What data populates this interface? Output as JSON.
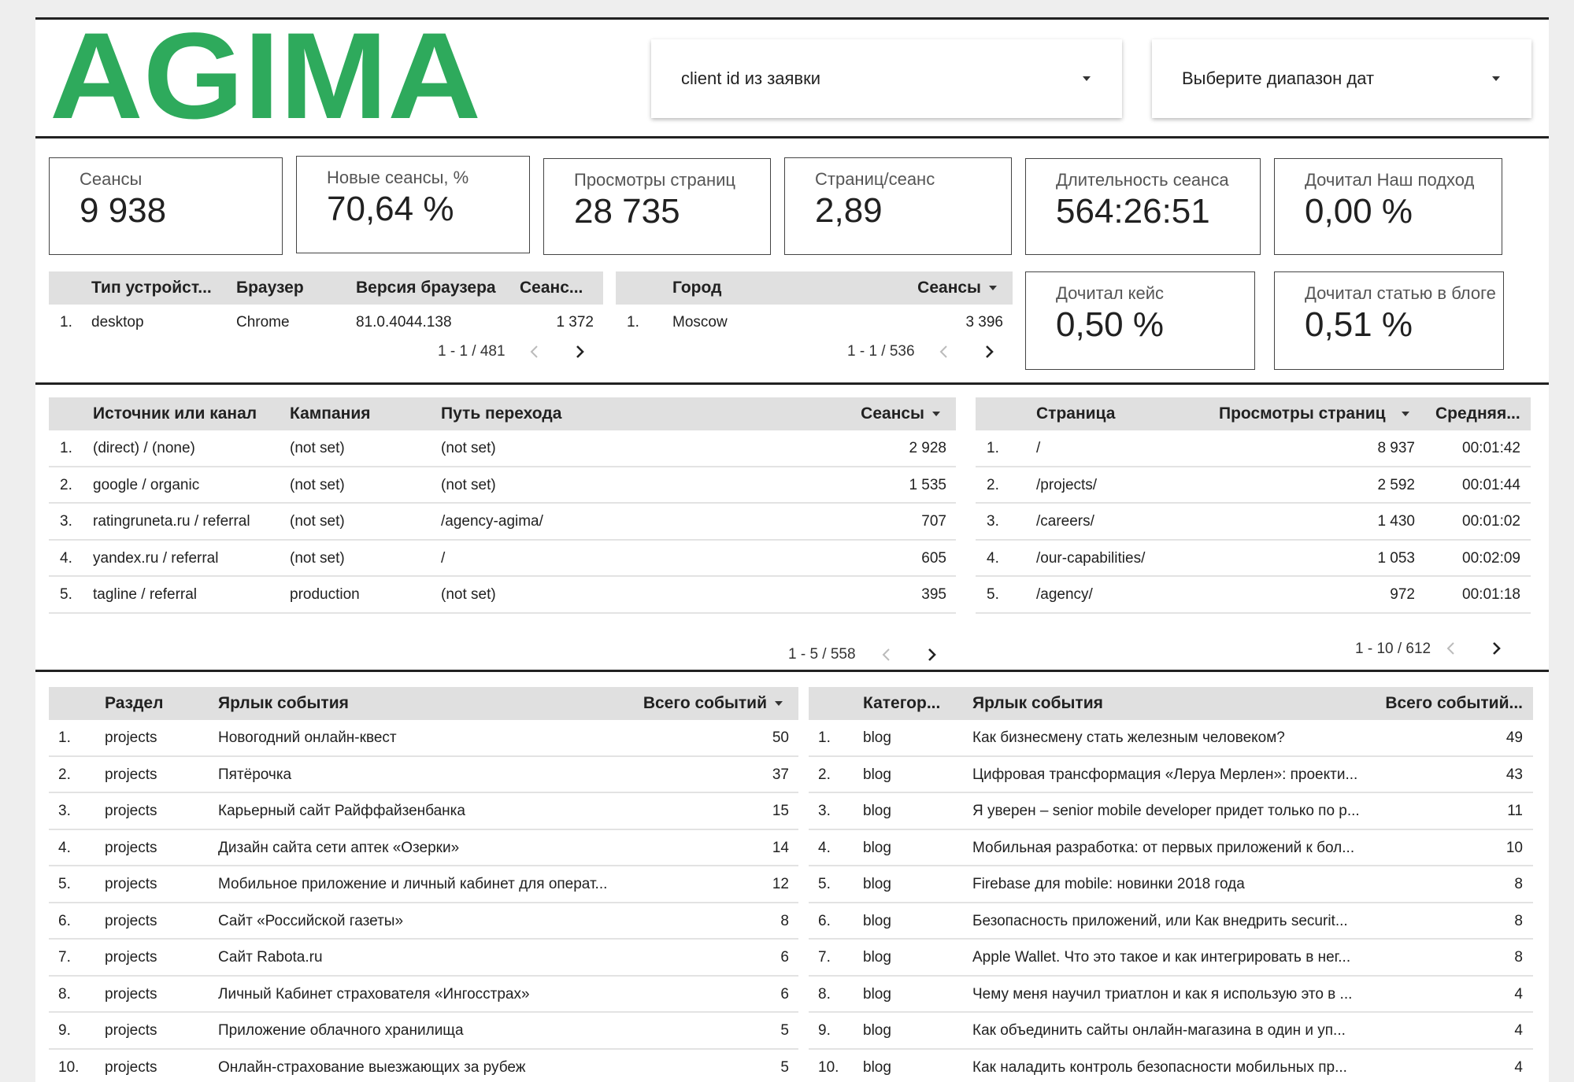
{
  "brand": {
    "logo_text": "AGIMA",
    "color": "#2eaa5c"
  },
  "filters": {
    "client_id": "client id из заявки",
    "date_range": "Выберите диапазон дат"
  },
  "scorecards": [
    {
      "label": "Сеансы",
      "value": "9 938"
    },
    {
      "label": "Новые сеансы, %",
      "value": "70,64 %"
    },
    {
      "label": "Просмотры страниц",
      "value": "28 735"
    },
    {
      "label": "Страниц/сеанс",
      "value": "2,89"
    },
    {
      "label": "Длительность сеанса",
      "value": "564:26:51"
    },
    {
      "label": "Дочитал Наш подход",
      "value": "0,00 %"
    },
    {
      "label": "Дочитал кейс",
      "value": "0,50 %"
    },
    {
      "label": "Дочитал статью в блоге",
      "value": "0,51 %"
    }
  ],
  "device_table": {
    "headers": [
      "Тип устройст...",
      "Браузер",
      "Версия браузера",
      "Сеанс..."
    ],
    "rows": [
      {
        "n": "1.",
        "device": "desktop",
        "browser": "Chrome",
        "version": "81.0.4044.138",
        "sessions": "1 372"
      }
    ],
    "pager": "1 - 1 / 481"
  },
  "city_table": {
    "headers": [
      "Город",
      "Сеансы"
    ],
    "rows": [
      {
        "n": "1.",
        "city": "Moscow",
        "sessions": "3 396"
      }
    ],
    "pager": "1 - 1 / 536"
  },
  "source_table": {
    "headers": [
      "Источник или канал",
      "Кампания",
      "Путь перехода",
      "Сеансы"
    ],
    "rows": [
      {
        "n": "1.",
        "source": "(direct) / (none)",
        "campaign": "(not set)",
        "path": "(not set)",
        "sessions": "2 928"
      },
      {
        "n": "2.",
        "source": "google / organic",
        "campaign": "(not set)",
        "path": "(not set)",
        "sessions": "1 535"
      },
      {
        "n": "3.",
        "source": "ratingruneta.ru / referral",
        "campaign": "(not set)",
        "path": "/agency-agima/",
        "sessions": "707"
      },
      {
        "n": "4.",
        "source": "yandex.ru / referral",
        "campaign": "(not set)",
        "path": "/",
        "sessions": "605"
      },
      {
        "n": "5.",
        "source": "tagline / referral",
        "campaign": "production",
        "path": "(not set)",
        "sessions": "395"
      }
    ],
    "pager": "1 - 5 / 558"
  },
  "pages_table": {
    "headers": [
      "Страница",
      "Просмотры страниц",
      "Средняя..."
    ],
    "rows": [
      {
        "n": "1.",
        "page": "/",
        "views": "8 937",
        "avg": "00:01:42"
      },
      {
        "n": "2.",
        "page": "/projects/",
        "views": "2 592",
        "avg": "00:01:44"
      },
      {
        "n": "3.",
        "page": "/careers/",
        "views": "1 430",
        "avg": "00:01:02"
      },
      {
        "n": "4.",
        "page": "/our-capabilities/",
        "views": "1 053",
        "avg": "00:02:09"
      },
      {
        "n": "5.",
        "page": "/agency/",
        "views": "972",
        "avg": "00:01:18"
      }
    ],
    "pager": "1 - 10 / 612"
  },
  "projects_events": {
    "headers": [
      "Раздел",
      "Ярлык события",
      "Всего событий"
    ],
    "rows": [
      {
        "n": "1.",
        "section": "projects",
        "label": "Новогодний онлайн-квест",
        "total": "50"
      },
      {
        "n": "2.",
        "section": "projects",
        "label": "Пятёрочка",
        "total": "37"
      },
      {
        "n": "3.",
        "section": "projects",
        "label": "Карьерный сайт Райффайзенбанка",
        "total": "15"
      },
      {
        "n": "4.",
        "section": "projects",
        "label": "Дизайн сайта сети аптек «Озерки»",
        "total": "14"
      },
      {
        "n": "5.",
        "section": "projects",
        "label": "Мобильное приложение и личный кабинет для операт...",
        "total": "12"
      },
      {
        "n": "6.",
        "section": "projects",
        "label": "Сайт «Российской газеты»",
        "total": "8"
      },
      {
        "n": "7.",
        "section": "projects",
        "label": "Сайт Rabota.ru",
        "total": "6"
      },
      {
        "n": "8.",
        "section": "projects",
        "label": "Личный Кабинет страхователя «Ингосстрах»",
        "total": "6"
      },
      {
        "n": "9.",
        "section": "projects",
        "label": "Приложение облачного хранилища",
        "total": "5"
      },
      {
        "n": "10.",
        "section": "projects",
        "label": "Онлайн-страхование выезжающих за рубеж",
        "total": "5"
      }
    ]
  },
  "blog_events": {
    "headers": [
      "Категор...",
      "Ярлык события",
      "Всего событий..."
    ],
    "rows": [
      {
        "n": "1.",
        "category": "blog",
        "label": "Как бизнесмену стать железным человеком?",
        "total": "49"
      },
      {
        "n": "2.",
        "category": "blog",
        "label": "Цифровая трансформация «Леруа Мерлен»: проекти...",
        "total": "43"
      },
      {
        "n": "3.",
        "category": "blog",
        "label": "Я уверен – senior mobile developer придет только по р...",
        "total": "11"
      },
      {
        "n": "4.",
        "category": "blog",
        "label": "Мобильная разработка: от первых приложений к бол...",
        "total": "10"
      },
      {
        "n": "5.",
        "category": "blog",
        "label": "Firebase для mobile: новинки 2018 года",
        "total": "8"
      },
      {
        "n": "6.",
        "category": "blog",
        "label": "Безопасность приложений, или Как внедрить securit...",
        "total": "8"
      },
      {
        "n": "7.",
        "category": "blog",
        "label": "Apple Wallet. Что это такое и как интегрировать в нег...",
        "total": "8"
      },
      {
        "n": "8.",
        "category": "blog",
        "label": "Чему меня научил триатлон и как я использую это в ...",
        "total": "4"
      },
      {
        "n": "9.",
        "category": "blog",
        "label": "Как объединить сайты онлайн-магазина в один и уп...",
        "total": "4"
      },
      {
        "n": "10.",
        "category": "blog",
        "label": "Как наладить контроль безопасности мобильных пр...",
        "total": "4"
      }
    ]
  }
}
